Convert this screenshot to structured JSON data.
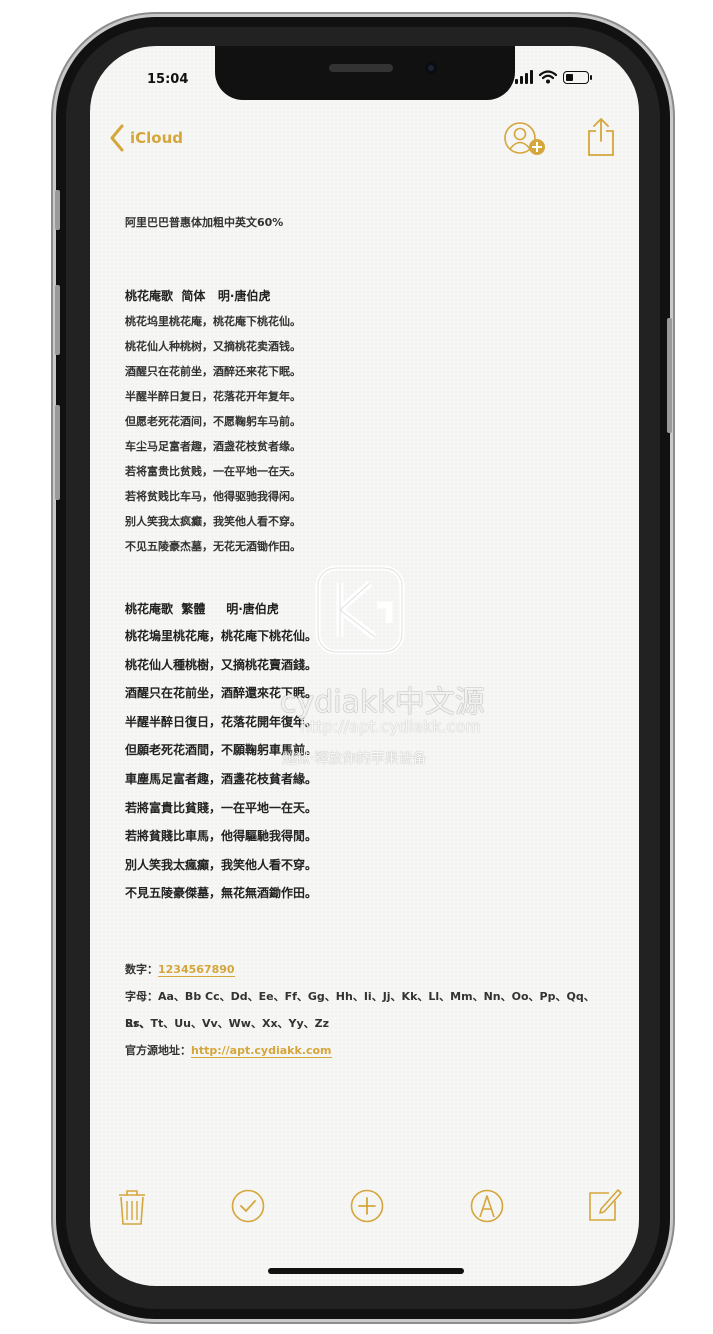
{
  "status_bar": {
    "time": "15:04",
    "battery_level": 0.35
  },
  "nav": {
    "back_label": "iCloud",
    "back_icon": "chevron-left-icon",
    "share_icon": "share-icon",
    "add_people_icon": "add-person-icon"
  },
  "note": {
    "title": "阿里巴巴普惠体加粗中英文60%",
    "simplified_heading": "桃花庵歌  简体   明·唐伯虎",
    "simplified_lines": [
      "桃花坞里桃花庵，桃花庵下桃花仙。",
      "桃花仙人种桃树，又摘桃花卖酒钱。",
      "酒醒只在花前坐，酒醉还来花下眠。",
      "半醒半醉日复日，花落花开年复年。",
      "但愿老死花酒间，不愿鞠躬车马前。",
      "车尘马足富者趣，酒盏花枝贫者缘。",
      "若将富贵比贫贱，一在平地一在天。",
      "若将贫贱比车马，他得驱驰我得闲。",
      "别人笑我太疯癫，我笑他人看不穿。",
      "不见五陵豪杰墓，无花无酒锄作田。"
    ],
    "traditional_heading": "桃花庵歌  繁體     明·唐伯虎",
    "traditional_lines": [
      "桃花塢里桃花庵，桃花庵下桃花仙。",
      "桃花仙人種桃樹，又摘桃花賣酒錢。",
      "酒醒只在花前坐，酒醉還來花下眠。",
      "半醒半醉日復日，花落花開年復年。",
      "但願老死花酒間，不願鞠躬車馬前。",
      "車塵馬足富者趣，酒盞花枝貧者緣。",
      "若將富貴比貧賤，一在平地一在天。",
      "若將貧賤比車馬，他得驅馳我得閒。",
      "別人笑我太瘋癲，我笑他人看不穿。",
      "不見五陵豪傑墓，無花無酒鋤作田。"
    ],
    "numbers_label": "数字：",
    "numbers_value": "1234567890",
    "letters_line1": "字母：Aa、Bb Cc、Dd、Ee、Ff、Gg、Hh、Ii、Jj、Kk、Ll、Mm、Nn、Oo、Pp、Qq、Rr、",
    "letters_line2": "Ss、Tt、Uu、Vv、Ww、Xx、Yy、Zz",
    "source_label": "官方源地址：",
    "source_url": "http://apt.cydiakk.com"
  },
  "watermark": {
    "brand": "cydiakk中文源",
    "url": "http://apt.cydiakk.com",
    "slogan": "越狱·释放你的苹果设备"
  },
  "toolbar": {
    "delete_icon": "trash-icon",
    "checklist_icon": "checkmark-circle-icon",
    "add_icon": "plus-circle-icon",
    "markup_icon": "pen-circle-icon",
    "compose_icon": "compose-icon"
  },
  "colors": {
    "accent": "#d5a63b",
    "paper": "#f6f6f4",
    "text": "#333333"
  }
}
